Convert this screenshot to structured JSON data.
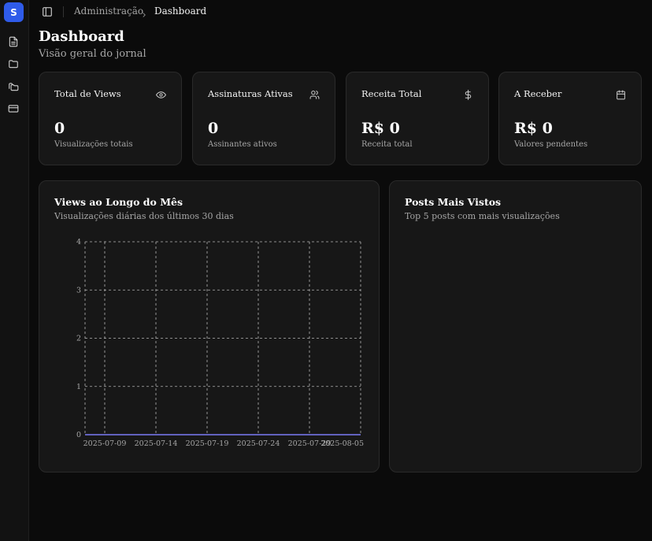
{
  "app": {
    "logo_letter": "S"
  },
  "sidebar": {
    "items": [
      {
        "icon": "file-text-icon"
      },
      {
        "icon": "folder-icon"
      },
      {
        "icon": "folders-icon"
      },
      {
        "icon": "credit-card-icon"
      }
    ]
  },
  "breadcrumb": {
    "parent": "Administração",
    "current": "Dashboard"
  },
  "page": {
    "title": "Dashboard",
    "subtitle": "Visão geral do jornal"
  },
  "stats": [
    {
      "title": "Total de Views",
      "value": "0",
      "desc": "Visualizações totais",
      "icon": "eye-icon"
    },
    {
      "title": "Assinaturas Ativas",
      "value": "0",
      "desc": "Assinantes ativos",
      "icon": "users-icon"
    },
    {
      "title": "Receita Total",
      "value": "R$ 0",
      "desc": "Receita total",
      "icon": "dollar-icon"
    },
    {
      "title": "A Receber",
      "value": "R$ 0",
      "desc": "Valores pendentes",
      "icon": "calendar-icon"
    }
  ],
  "views_panel": {
    "title": "Views ao Longo do Mês",
    "subtitle": "Visualizações diárias dos últimos 30 dias"
  },
  "posts_panel": {
    "title": "Posts Mais Vistos",
    "subtitle": "Top 5 posts com mais visualizações"
  },
  "colors": {
    "line": "#7c7cf5",
    "grid": "#cfcfcf"
  },
  "chart_data": {
    "type": "line",
    "x": [
      "2025-07-09",
      "2025-07-14",
      "2025-07-19",
      "2025-07-24",
      "2025-07-29",
      "2025-08-05"
    ],
    "series": [
      {
        "values": [
          0,
          0,
          0,
          0,
          0,
          0
        ]
      }
    ],
    "yticks": [
      0,
      1,
      2,
      3,
      4
    ],
    "ylim": [
      0,
      4
    ],
    "grid": true
  }
}
